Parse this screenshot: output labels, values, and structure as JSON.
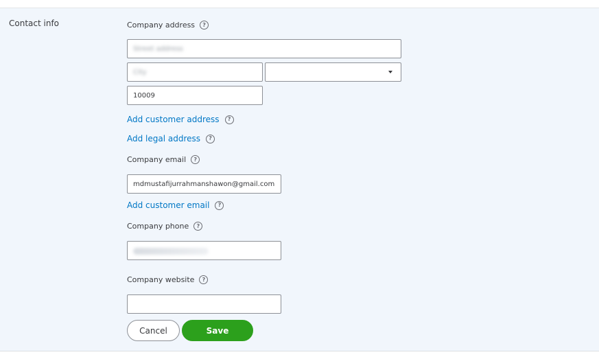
{
  "section": {
    "label": "Contact info"
  },
  "address": {
    "label": "Company address",
    "help_icon": "question-circle-icon",
    "street_placeholder": "Street address",
    "city_placeholder": "City",
    "state_value": "",
    "zip_value": "10009"
  },
  "links": {
    "customer_address": "Add customer address",
    "legal_address": "Add legal address",
    "customer_email": "Add customer email"
  },
  "email": {
    "label": "Company email",
    "value": "mdmustafijurrahmanshawon@gmail.com"
  },
  "phone": {
    "label": "Company phone",
    "value": ""
  },
  "website": {
    "label": "Company website",
    "value": ""
  },
  "buttons": {
    "cancel": "Cancel",
    "save": "Save"
  },
  "colors": {
    "panel_bg": "#f1f6fc",
    "link": "#0077c5",
    "save": "#2ca01c"
  }
}
